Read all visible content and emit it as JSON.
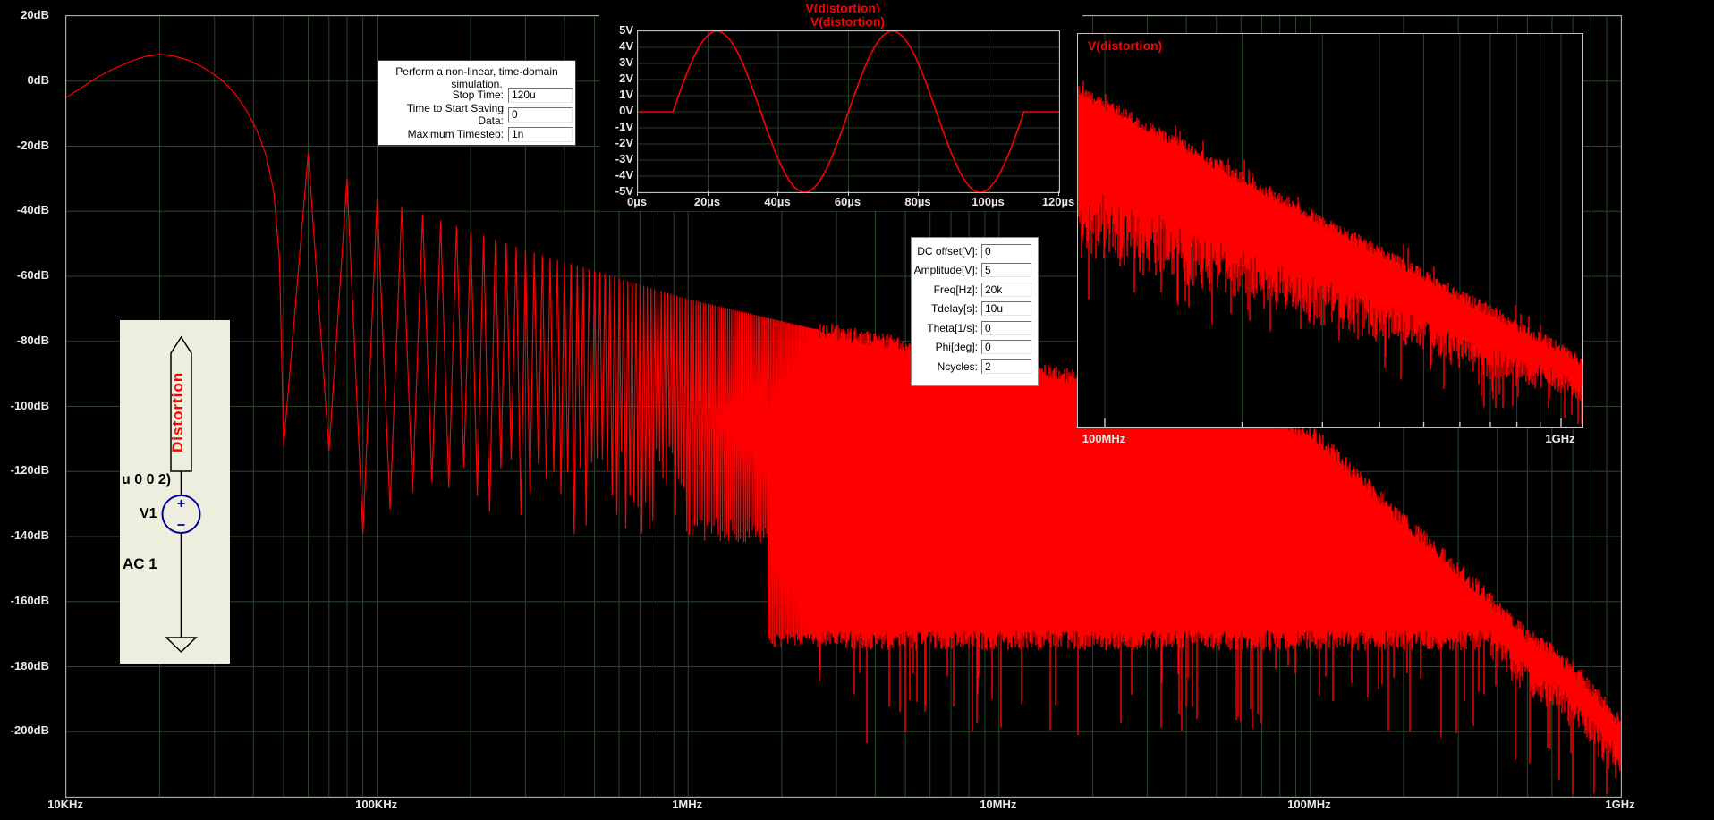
{
  "colors": {
    "trace_red": "#ff0000",
    "grid_green": "#2c462c",
    "inset_grid": "#224022",
    "axis_text": "#e9e9e9",
    "frame": "#a8a8a8",
    "tick_white": "#cccccc",
    "schematic_bg": "#eeeede",
    "symbol_navy": "#00009b"
  },
  "sim_note": {
    "text": "Perform a non-linear, time-domain simulation.",
    "fields": [
      {
        "label": "Stop Time:",
        "value": "120u"
      },
      {
        "label": "Time to Start Saving Data:",
        "value": "0"
      },
      {
        "label": "Maximum Timestep:",
        "value": "1n"
      }
    ]
  },
  "source_params": {
    "fields": [
      {
        "label": "DC offset[V]:",
        "value": "0"
      },
      {
        "label": "Amplitude[V]:",
        "value": "5"
      },
      {
        "label": "Freq[Hz]:",
        "value": "20k"
      },
      {
        "label": "Tdelay[s]:",
        "value": "10u"
      },
      {
        "label": "Theta[1/s]:",
        "value": "0"
      },
      {
        "label": "Phi[deg]:",
        "value": "0"
      },
      {
        "label": "Ncycles:",
        "value": "2"
      }
    ]
  },
  "schematic": {
    "net_label": "Distortion",
    "partial_text": "u 0 0 2)",
    "ref": "V1",
    "ac_text": "AC 1"
  },
  "chart_data": [
    {
      "type": "line",
      "id": "main_fft",
      "title": "V(distortion)",
      "x_axis": {
        "scale": "log",
        "ticks": [
          "10KHz",
          "100KHz",
          "1MHz",
          "10MHz",
          "100MHz",
          "1GHz"
        ],
        "range_hz": [
          10000,
          1000000000
        ]
      },
      "y_axis": {
        "ticks": [
          "20dB",
          "0dB",
          "-20dB",
          "-40dB",
          "-60dB",
          "-80dB",
          "-100dB",
          "-120dB",
          "-140dB",
          "-160dB",
          "-180dB",
          "-200dB"
        ],
        "range_db": [
          -220,
          20
        ],
        "step_db": 20
      },
      "main_lobe_points_hz_db": [
        [
          10000,
          -5
        ],
        [
          11000,
          -2.5
        ],
        [
          12500,
          1
        ],
        [
          14000,
          3.5
        ],
        [
          16000,
          6
        ],
        [
          18000,
          7.6
        ],
        [
          20000,
          8.2
        ],
        [
          22000,
          7.8
        ],
        [
          25000,
          6.3
        ],
        [
          28000,
          3.8
        ],
        [
          31500,
          0.5
        ],
        [
          35000,
          -4
        ],
        [
          38000,
          -9
        ],
        [
          41000,
          -15
        ],
        [
          44000,
          -23
        ],
        [
          46500,
          -34
        ],
        [
          48500,
          -55
        ],
        [
          49600,
          -95
        ]
      ],
      "lobe_envelope_hz_db": [
        [
          10000,
          -5
        ],
        [
          20000,
          8.2
        ],
        [
          60000,
          -22
        ],
        [
          100000,
          -36
        ],
        [
          300000,
          -52
        ],
        [
          1000000,
          -67
        ],
        [
          2500000,
          -76
        ],
        [
          10000000,
          -86
        ],
        [
          30000000,
          -96
        ],
        [
          100000000,
          -107
        ],
        [
          176000000,
          -130
        ],
        [
          300000000,
          -150
        ],
        [
          500000000,
          -170
        ],
        [
          700000000,
          -180
        ],
        [
          1000000000,
          -197
        ]
      ],
      "nulls": {
        "first_hz": 50000,
        "spacing_hz": 20000,
        "resolved_depth_db_range": [
          -140,
          -112
        ],
        "mid_depth_db": -130,
        "merge_hz": 2600000
      },
      "noise_floor_db": -172
    },
    {
      "type": "line",
      "id": "transient",
      "title": "V(distortion)",
      "x_ticks": [
        "0µs",
        "20µs",
        "40µs",
        "60µs",
        "80µs",
        "100µs",
        "120µs"
      ],
      "y_ticks": [
        "5V",
        "4V",
        "3V",
        "2V",
        "1V",
        "0V",
        "-1V",
        "-2V",
        "-3V",
        "-4V",
        "-5V"
      ],
      "waveform": {
        "kind": "sine_burst",
        "amplitude_v": 5,
        "freq_hz": 20000,
        "tdelay_us": 10,
        "ncycles": 2,
        "total_us": 120
      }
    },
    {
      "type": "line",
      "id": "fft_zoom",
      "title": "V(distortion)",
      "x_ticks": [
        "100MHz",
        "1GHz"
      ],
      "x_axis": {
        "scale": "log",
        "range_hz": [
          100000000,
          1000000000
        ]
      },
      "y_axis": {
        "labels_visible": false
      },
      "band": {
        "top_frac_start": 0.14,
        "top_frac_end": 0.83,
        "thickness_frac_start": 0.33,
        "thickness_frac_end": 0.08
      }
    }
  ]
}
